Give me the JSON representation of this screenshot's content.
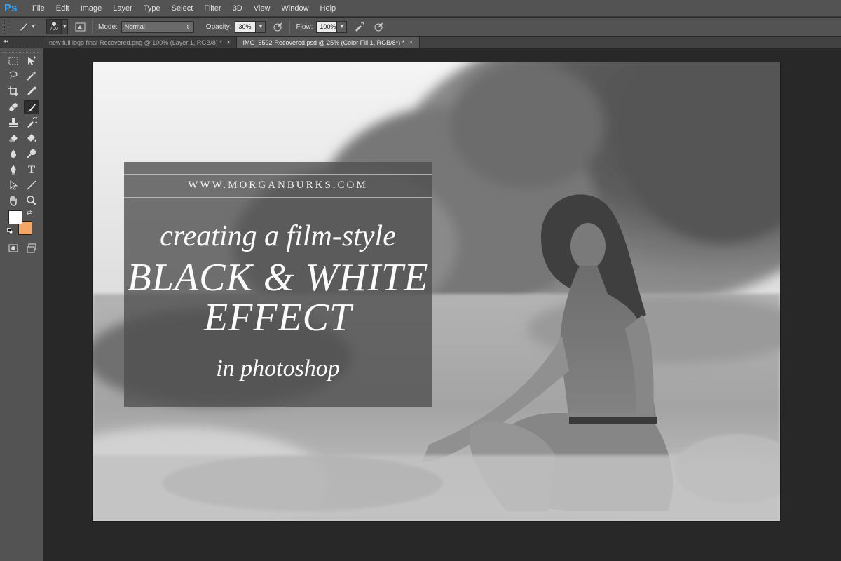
{
  "app": {
    "logo": "Ps"
  },
  "menu": [
    "File",
    "Edit",
    "Image",
    "Layer",
    "Type",
    "Select",
    "Filter",
    "3D",
    "View",
    "Window",
    "Help"
  ],
  "options": {
    "brush_size": "700",
    "mode_label": "Mode:",
    "mode_value": "Normal",
    "opacity_label": "Opacity:",
    "opacity_value": "30%",
    "flow_label": "Flow:",
    "flow_value": "100%"
  },
  "tabs": [
    {
      "label": "new full logo final-Recovered.png @ 100% (Layer 1, RGB/8) *",
      "active": false
    },
    {
      "label": "IMG_6592-Recovered.psd @ 25% (Color Fill 1, RGB/8*) *",
      "active": true
    }
  ],
  "colors": {
    "foreground": "#ffffff",
    "background": "#f2a864",
    "accent": "#31a8ff"
  },
  "tools": [
    "marquee-icon",
    "move-icon",
    "lasso-icon",
    "magic-wand-icon",
    "crop-icon",
    "eyedropper-icon",
    "healing-brush-icon",
    "brush-icon",
    "clone-stamp-icon",
    "history-brush-icon",
    "eraser-icon",
    "paint-bucket-icon",
    "blur-icon",
    "dodge-icon",
    "pen-icon",
    "type-icon",
    "path-selection-icon",
    "line-icon",
    "hand-icon",
    "zoom-icon"
  ],
  "overlay": {
    "url": "WWW.MORGANBURKS.COM",
    "line1": "creating a film-style",
    "line2": "BLACK & WHITE",
    "line3": "EFFECT",
    "line4": "in photoshop"
  }
}
